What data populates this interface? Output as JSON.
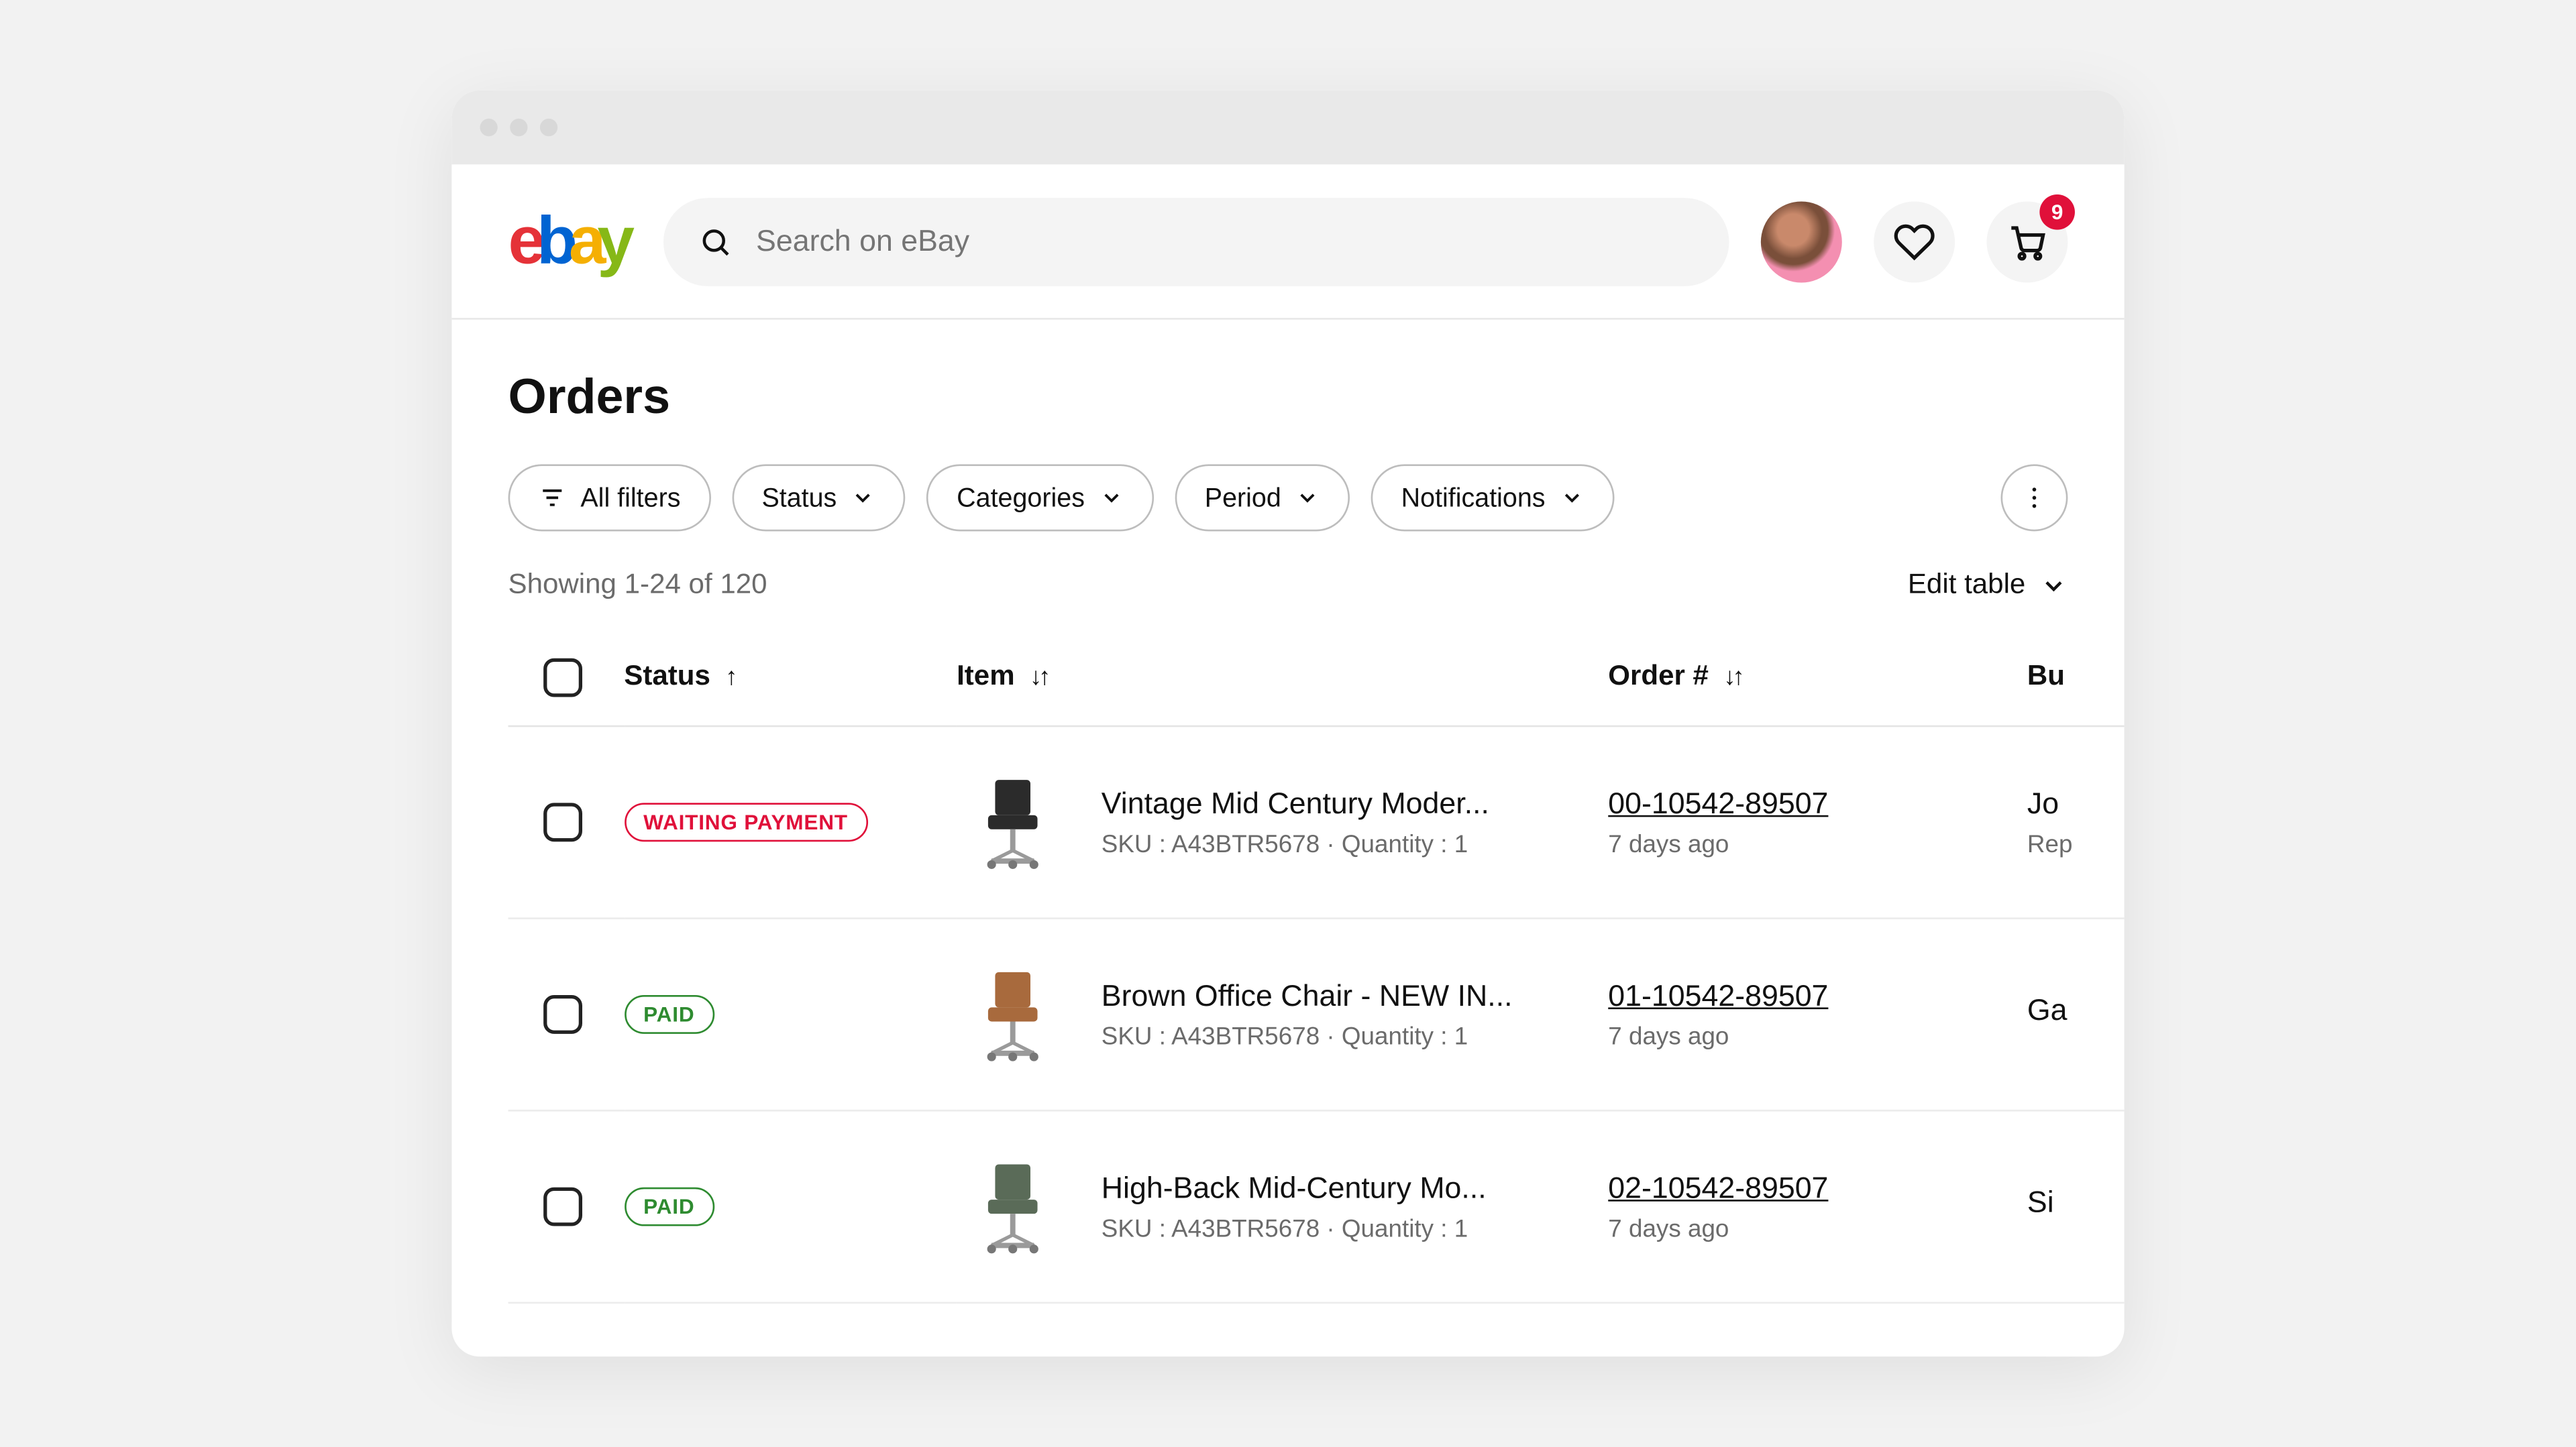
{
  "header": {
    "search_placeholder": "Search on eBay",
    "cart_badge": "9"
  },
  "page": {
    "title": "Orders",
    "filters": {
      "all": "All filters",
      "status": "Status",
      "categories": "Categories",
      "period": "Period",
      "notifications": "Notifications"
    },
    "showing": "Showing 1-24 of 120",
    "edit_table": "Edit table"
  },
  "columns": {
    "status": "Status",
    "item": "Item",
    "order": "Order #",
    "buyer": "Bu"
  },
  "rows": [
    {
      "status_label": "WAITING PAYMENT",
      "status_kind": "waiting",
      "item_title": "Vintage Mid Century Moder...",
      "item_sub": "SKU : A43BTR5678  ·  Quantity : 1",
      "order_num": "00-10542-89507",
      "order_age": "7 days ago",
      "buyer": "Jo",
      "buyer_sub": "Rep",
      "thumb_color": "#2b2b2b"
    },
    {
      "status_label": "PAID",
      "status_kind": "paid",
      "item_title": "Brown Office Chair - NEW IN...",
      "item_sub": "SKU : A43BTR5678  ·  Quantity : 1",
      "order_num": "01-10542-89507",
      "order_age": "7 days ago",
      "buyer": "Ga",
      "buyer_sub": "",
      "thumb_color": "#a86a3d"
    },
    {
      "status_label": "PAID",
      "status_kind": "paid",
      "item_title": "High-Back Mid-Century Mo...",
      "item_sub": "SKU : A43BTR5678  ·  Quantity : 1",
      "order_num": "02-10542-89507",
      "order_age": "7 days ago",
      "buyer": "Si",
      "buyer_sub": "",
      "thumb_color": "#5a6b58"
    }
  ]
}
